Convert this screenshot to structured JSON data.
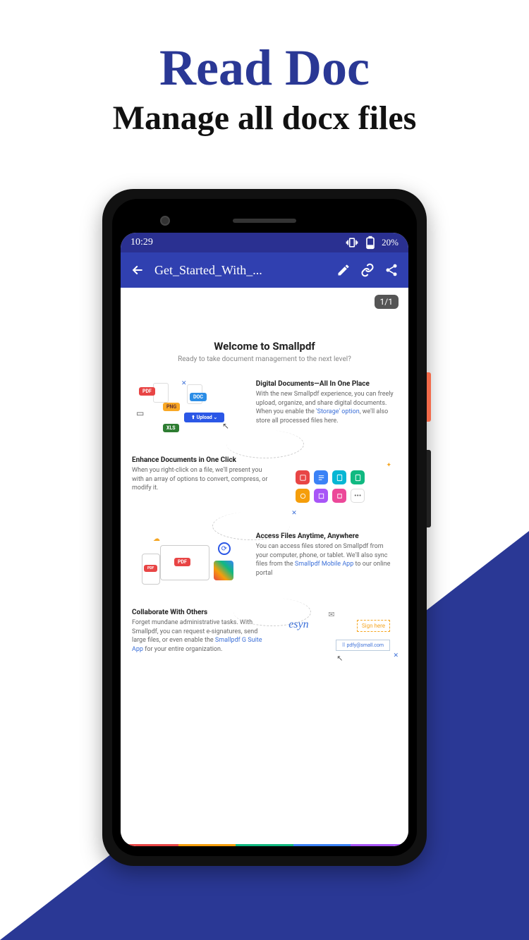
{
  "headline": "Read Doc",
  "subhead": "Manage all docx files",
  "statusbar": {
    "time": "10:29",
    "battery": "20%"
  },
  "appbar": {
    "title": "Get_Started_With_..."
  },
  "page_counter": "1/1",
  "doc": {
    "title": "Welcome to Smallpdf",
    "subtitle": "Ready to take document management to the next level?",
    "sections": [
      {
        "heading": "Digital Documents—All In One Place",
        "text_a": "With the new Smallpdf experience, you can freely upload, organize, and share digital documents. When you enable the ",
        "link": "'Storage' option",
        "text_b": ", we'll also store all processed files here."
      },
      {
        "heading": "Enhance Documents in One Click",
        "text_a": "When you right-click on a file, we'll present you with an array of options to convert, compress, or modify it.",
        "link": "",
        "text_b": ""
      },
      {
        "heading": "Access Files Anytime, Anywhere",
        "text_a": "You can access files stored on Smallpdf from your computer, phone, or tablet. We'll also sync files from the ",
        "link": "Smallpdf Mobile App",
        "text_b": " to our online portal"
      },
      {
        "heading": "Collaborate With Others",
        "text_a": "Forget mundane administrative tasks. With Smallpdf, you can request e-signatures, send large files, or even enable the ",
        "link": "Smallpdf G Suite App",
        "text_b": " for your entire organization."
      }
    ]
  },
  "graphic1": {
    "pdf": "PDF",
    "png": "PNG",
    "doc": "DOC",
    "xls": "XLS",
    "upload": "Upload"
  },
  "graphic4": {
    "sign": "Sign here",
    "email": "pdfy@small.com",
    "scribble": "esyn"
  }
}
